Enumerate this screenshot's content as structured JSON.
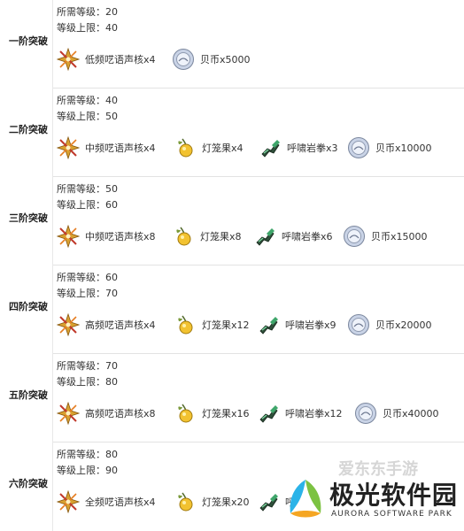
{
  "tiers": [
    {
      "name": "一阶突破",
      "required_level": "所需等级：20",
      "level_cap": "等级上限：40",
      "materials": [
        {
          "icon": "core-crystal-icon",
          "label": "低频呓语声核x4"
        },
        {
          "icon": "shell-coin-icon",
          "label": "贝币x5000"
        }
      ]
    },
    {
      "name": "二阶突破",
      "required_level": "所需等级：40",
      "level_cap": "等级上限：50",
      "materials": [
        {
          "icon": "core-crystal-icon",
          "label": "中频呓语声核x4"
        },
        {
          "icon": "lantern-fruit-icon",
          "label": "灯笼果x4"
        },
        {
          "icon": "roaring-rock-fist-icon",
          "label": "呼啸岩拳x3"
        },
        {
          "icon": "shell-coin-icon",
          "label": "贝币x10000"
        }
      ]
    },
    {
      "name": "三阶突破",
      "required_level": "所需等级：50",
      "level_cap": "等级上限：60",
      "materials": [
        {
          "icon": "core-crystal-icon",
          "label": "中频呓语声核x8"
        },
        {
          "icon": "lantern-fruit-icon",
          "label": "灯笼果x8"
        },
        {
          "icon": "roaring-rock-fist-icon",
          "label": "呼啸岩拳x6"
        },
        {
          "icon": "shell-coin-icon",
          "label": "贝币x15000"
        }
      ]
    },
    {
      "name": "四阶突破",
      "required_level": "所需等级：60",
      "level_cap": "等级上限：70",
      "materials": [
        {
          "icon": "core-crystal-icon",
          "label": "高频呓语声核x4"
        },
        {
          "icon": "lantern-fruit-icon",
          "label": "灯笼果x12"
        },
        {
          "icon": "roaring-rock-fist-icon",
          "label": "呼啸岩拳x9"
        },
        {
          "icon": "shell-coin-icon",
          "label": "贝币x20000"
        }
      ]
    },
    {
      "name": "五阶突破",
      "required_level": "所需等级：70",
      "level_cap": "等级上限：80",
      "materials": [
        {
          "icon": "core-crystal-icon",
          "label": "高频呓语声核x8"
        },
        {
          "icon": "lantern-fruit-icon",
          "label": "灯笼果x16"
        },
        {
          "icon": "roaring-rock-fist-icon",
          "label": "呼啸岩拳x12"
        },
        {
          "icon": "shell-coin-icon",
          "label": "贝币x40000"
        }
      ]
    },
    {
      "name": "六阶突破",
      "required_level": "所需等级：80",
      "level_cap": "等级上限：90",
      "materials": [
        {
          "icon": "core-crystal-icon",
          "label": "全频呓语声核x4"
        },
        {
          "icon": "lantern-fruit-icon",
          "label": "灯笼果x20"
        },
        {
          "icon": "roaring-rock-fist-icon",
          "label": "呼"
        }
      ]
    }
  ],
  "watermark": {
    "top_text": "爱东东手游",
    "main_text": "极光软件园",
    "sub_text": "AURORA SOFTWARE PARK"
  }
}
